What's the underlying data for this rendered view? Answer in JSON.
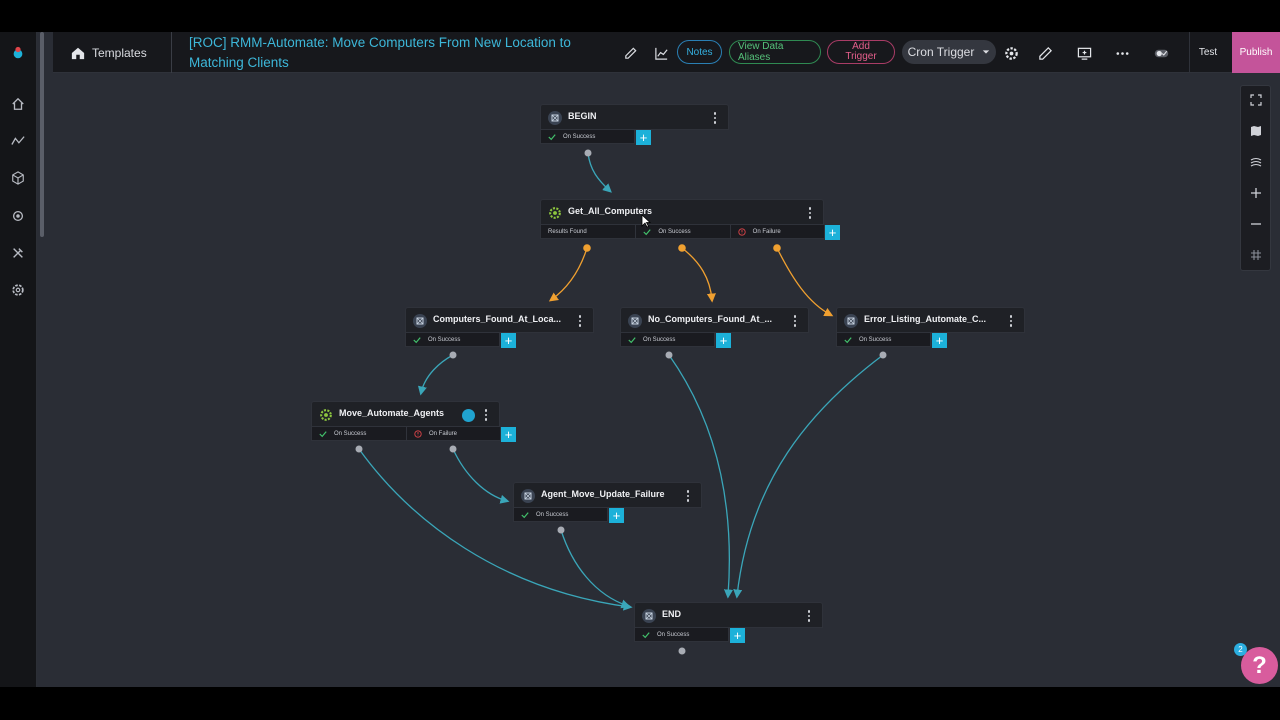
{
  "topbar": {
    "templates_label": "Templates",
    "script_title": "[ROC] RMM-Automate: Move Computers From New Location to Matching Clients",
    "notes_label": "Notes",
    "aliases_label": "View Data Aliases",
    "add_trigger_line1": "Add",
    "add_trigger_line2": "Trigger",
    "trigger_select_value": "Cron Trigger",
    "test_label": "Test",
    "publish_label": "Publish"
  },
  "colors": {
    "accent_cyan": "#1cb1d9",
    "success_wire": "#3aa6b9",
    "results_wire": "#f0a030",
    "publish": "#c4549a",
    "failure": "#e0454a"
  },
  "nodes": {
    "begin": {
      "title": "BEGIN",
      "ports": [
        "On Success"
      ]
    },
    "get_all": {
      "title": "Get_All_Computers",
      "ports": [
        "Results Found",
        "On Success",
        "On Failure"
      ]
    },
    "found": {
      "title": "Computers_Found_At_Loca...",
      "ports": [
        "On Success"
      ]
    },
    "no_found": {
      "title": "No_Computers_Found_At_...",
      "ports": [
        "On Success"
      ]
    },
    "error": {
      "title": "Error_Listing_Automate_C...",
      "ports": [
        "On Success"
      ]
    },
    "move": {
      "title": "Move_Automate_Agents",
      "ports": [
        "On Success",
        "On Failure"
      ]
    },
    "agent_fail": {
      "title": "Agent_Move_Update_Failure",
      "ports": [
        "On Success"
      ]
    },
    "end": {
      "title": "END",
      "ports": [
        "On Success"
      ]
    }
  },
  "help": {
    "badge_count": "2",
    "symbol": "?"
  },
  "icons": {
    "rail": [
      "home-icon",
      "flow-icon",
      "cube-icon",
      "gear-icon",
      "tools-icon",
      "settings-icon"
    ],
    "tools": [
      "fullscreen-icon",
      "map-icon",
      "layers-icon",
      "zoom-in-icon",
      "zoom-out-icon",
      "grid-icon"
    ]
  }
}
